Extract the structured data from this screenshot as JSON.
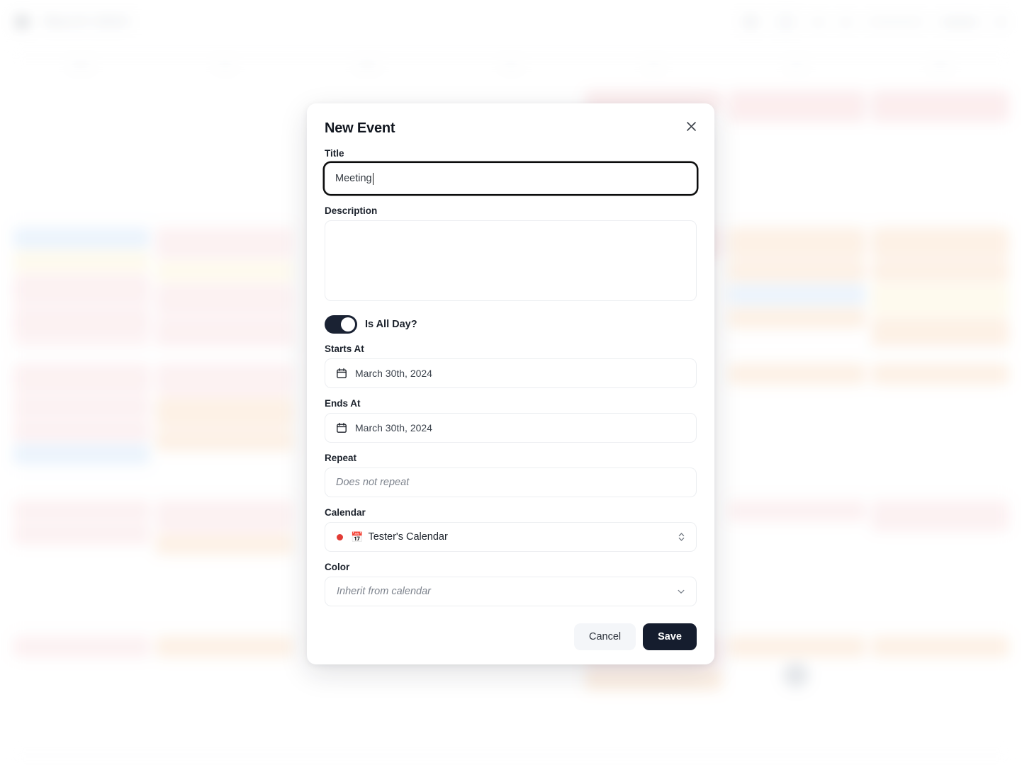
{
  "background": {
    "header": {
      "back_icon": "chevron-left-icon",
      "month_title": "March 2024",
      "toolbar_icons": [
        "circle-icon",
        "calendar-view-icon",
        "dot-icon",
        "dot-icon"
      ],
      "account_label": "",
      "menu_label": ""
    },
    "day_headers": [
      "MON",
      "TUE",
      "WED",
      "THU",
      "FRI",
      "SAT",
      "SUN"
    ],
    "weeks": [
      {
        "days": [
          {
            "num": "",
            "events": []
          },
          {
            "num": "",
            "events": []
          },
          {
            "num": "",
            "events": []
          },
          {
            "num": "",
            "events": []
          },
          {
            "num": "",
            "events": [
              "red"
            ]
          },
          {
            "num": "",
            "events": [
              "red-tall"
            ]
          },
          {
            "num": "",
            "events": [
              "red-tall"
            ]
          }
        ]
      },
      {
        "days": [
          {
            "num": "",
            "events": [
              "blue",
              "yellow",
              "rose-tall",
              "rose-tall",
              "rose",
              "rose-tall"
            ]
          },
          {
            "num": "",
            "events": [
              "rose-tall",
              "yellow",
              "rose-tall",
              "rose-tall",
              "violet",
              "rose-tall"
            ]
          },
          {
            "num": "",
            "events": []
          },
          {
            "num": "",
            "events": []
          },
          {
            "num": "",
            "events": [
              "rose-tall"
            ]
          },
          {
            "num": "",
            "events": [
              "orange-tall",
              "orange",
              "blue",
              "orange"
            ]
          },
          {
            "num": "",
            "events": [
              "orange-tall",
              "orange",
              "yellow-tall",
              "orange-tall",
              "blue",
              "orange-tall"
            ]
          }
        ]
      },
      {
        "days": [
          {
            "num": "",
            "events": [
              "rose-tall",
              "rose",
              "rose",
              "blue"
            ]
          },
          {
            "num": "",
            "events": [
              "rose-tall",
              "orange-tall",
              "orange"
            ]
          },
          {
            "num": "",
            "events": []
          },
          {
            "num": "",
            "events": []
          },
          {
            "num": "",
            "events": []
          },
          {
            "num": "",
            "events": [
              "orange"
            ]
          },
          {
            "num": "",
            "events": [
              "orange"
            ]
          }
        ]
      },
      {
        "days": [
          {
            "num": "",
            "events": [
              "rose",
              "rose"
            ]
          },
          {
            "num": "",
            "events": [
              "rose-tall",
              "orange"
            ]
          },
          {
            "num": "",
            "events": []
          },
          {
            "num": "",
            "events": []
          },
          {
            "num": "",
            "events": []
          },
          {
            "num": "",
            "events": [
              "rose"
            ]
          },
          {
            "num": "",
            "events": [
              "rose-tall"
            ]
          }
        ]
      },
      {
        "days": [
          {
            "num": "",
            "events": [
              "rose"
            ]
          },
          {
            "num": "",
            "events": [
              "orange"
            ]
          },
          {
            "num": "",
            "events": []
          },
          {
            "num": "",
            "events": []
          },
          {
            "num": "",
            "events": [
              "rose-tall",
              "orange"
            ]
          },
          {
            "num": "",
            "events": [
              "orange"
            ]
          },
          {
            "num": "",
            "events": [
              "orange"
            ]
          }
        ]
      }
    ],
    "fab_icon": "add-event-button"
  },
  "dialog": {
    "heading": "New Event",
    "close_icon": "close-icon",
    "title": {
      "label": "Title",
      "value": "Meeting",
      "placeholder": ""
    },
    "description": {
      "label": "Description",
      "value": "",
      "placeholder": ""
    },
    "all_day": {
      "label": "Is All Day?",
      "enabled": "true"
    },
    "starts_at": {
      "label": "Starts At",
      "value": "March 30th, 2024",
      "icon": "calendar-icon"
    },
    "ends_at": {
      "label": "Ends At",
      "value": "March 30th, 2024",
      "icon": "calendar-icon"
    },
    "repeat": {
      "label": "Repeat",
      "placeholder": "Does not repeat",
      "value": ""
    },
    "calendar": {
      "label": "Calendar",
      "selected": "Tester's Calendar",
      "dot_color": "#e23b35",
      "emoji": "📅",
      "chevron_icon": "chevron-up-down-icon"
    },
    "color": {
      "label": "Color",
      "placeholder": "Inherit from calendar",
      "chevron_icon": "chevron-down-icon"
    },
    "footer": {
      "cancel_label": "Cancel",
      "save_label": "Save",
      "save_bg": "#151d2e",
      "cancel_bg": "#f4f6f9"
    }
  }
}
